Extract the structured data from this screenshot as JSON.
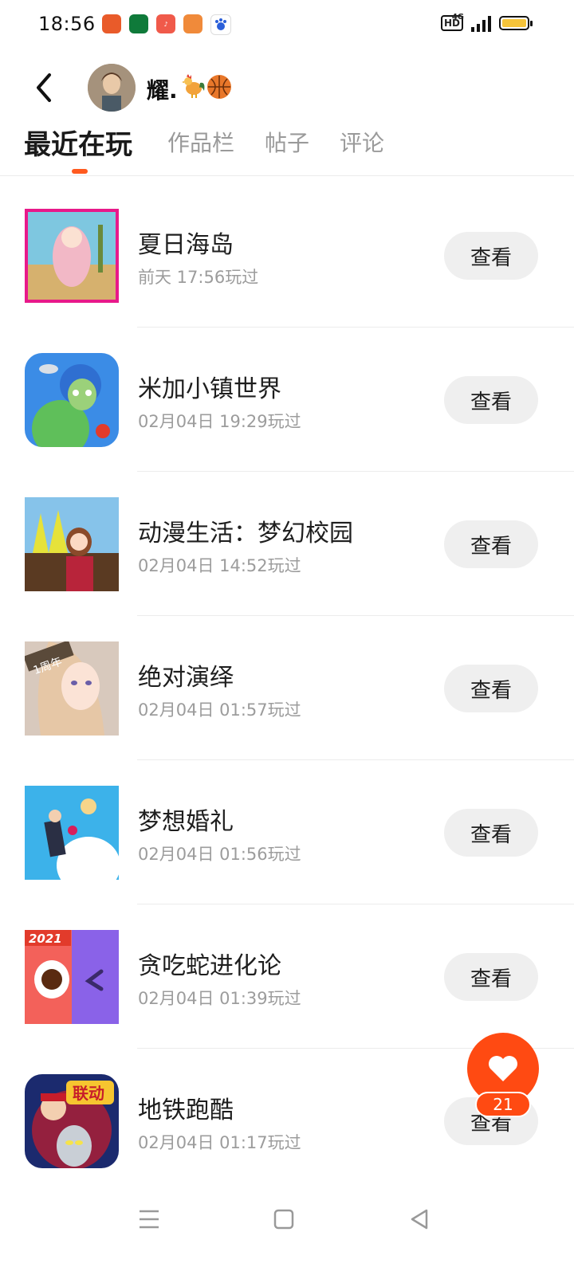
{
  "status_bar": {
    "time": "18:56",
    "network": "4G",
    "hd_badge": "HD",
    "notification_icons": [
      "app-icon-orange",
      "oppo-icon",
      "music-icon",
      "book-icon",
      "baidu-icon"
    ],
    "battery_color": "#f5c43a"
  },
  "header": {
    "username": "耀."
  },
  "tabs": [
    {
      "label": "最近在玩",
      "active": true
    },
    {
      "label": "作品栏",
      "active": false
    },
    {
      "label": "帖子",
      "active": false
    },
    {
      "label": "评论",
      "active": false
    }
  ],
  "games": [
    {
      "title": "夏日海岛",
      "played": "前天 17:56玩过",
      "action": "查看"
    },
    {
      "title": "米加小镇世界",
      "played": "02月04日 19:29玩过",
      "action": "查看"
    },
    {
      "title": "动漫生活：梦幻校园",
      "played": "02月04日 14:52玩过",
      "action": "查看"
    },
    {
      "title": "绝对演绎",
      "played": "02月04日 01:57玩过",
      "action": "查看"
    },
    {
      "title": "梦想婚礼",
      "played": "02月04日 01:56玩过",
      "action": "查看"
    },
    {
      "title": "贪吃蛇进化论",
      "played": "02月04日 01:39玩过",
      "action": "查看"
    },
    {
      "title": "地铁跑酷",
      "played": "02月04日 01:17玩过",
      "action": "查看"
    }
  ],
  "thumb_labels": {
    "g4": "1周年",
    "g6": "2021",
    "g7": "联动"
  },
  "like": {
    "count": "21"
  },
  "colors": {
    "accent": "#ff5a1f",
    "like": "#ff4a12"
  }
}
